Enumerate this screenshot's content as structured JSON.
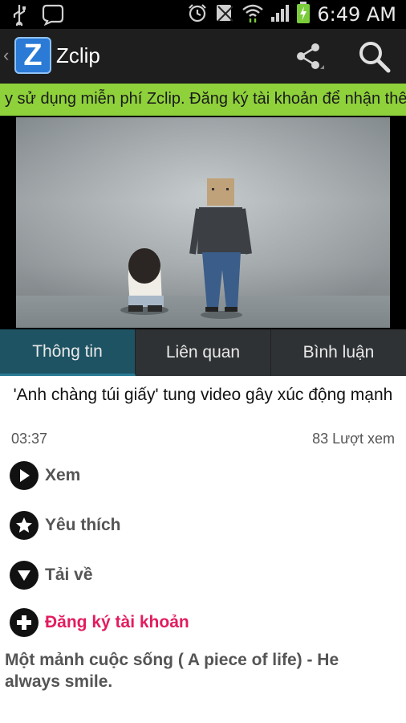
{
  "status_bar": {
    "time": "6:49 AM",
    "icons": [
      "usb-icon",
      "chat-icon",
      "alarm-icon",
      "no-sim-icon",
      "wifi-icon",
      "signal-icon",
      "battery-charging-icon"
    ]
  },
  "app_bar": {
    "logo_letter": "Z",
    "title": "Zclip",
    "icons": [
      "back-chevron-icon",
      "share-icon",
      "search-icon"
    ]
  },
  "marquee": {
    "text": "y sử dụng miễn phí Zclip. Đăng ký tài khoản để nhận thê"
  },
  "tabs": [
    {
      "label": "Thông tin",
      "active": true
    },
    {
      "label": "Liên quan",
      "active": false
    },
    {
      "label": "Bình luận",
      "active": false
    }
  ],
  "video": {
    "title": "'Anh chàng túi giấy' tung video gây xúc động mạnh",
    "duration": "03:37",
    "views": "83 Lượt xem"
  },
  "actions": [
    {
      "label": "Xem",
      "icon": "play-icon"
    },
    {
      "label": "Yêu thích",
      "icon": "star-icon"
    },
    {
      "label": "Tải về",
      "icon": "download-icon"
    },
    {
      "label": "Đăng ký tài khoản",
      "icon": "plus-icon"
    }
  ],
  "description": "Một mảnh cuộc sống ( A piece of life) - He always smile.",
  "colors": {
    "marquee_bg": "#8ed13a",
    "tab_active": "#1e5363",
    "signup_accent": "#e31c5f"
  }
}
